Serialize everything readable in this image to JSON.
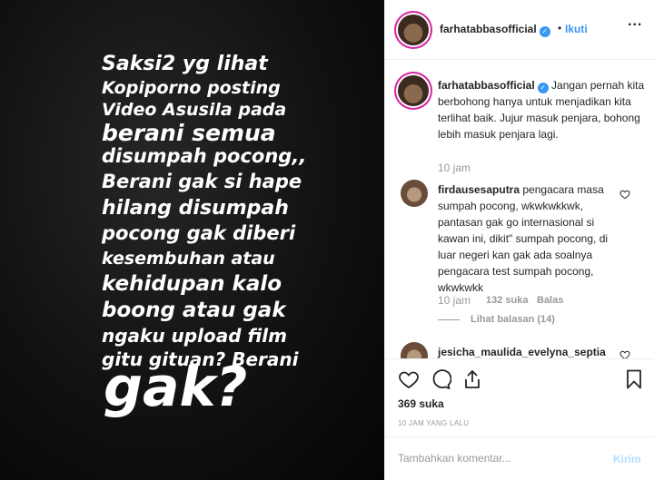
{
  "image_text": {
    "lines": [
      "Saksi2 yg lihat",
      "Kopiporno posting",
      "Video Asusila pada",
      "berani semua",
      "disumpah pocong,,",
      "Berani gak si hape",
      "hilang disumpah",
      "pocong gak diberi",
      "kesembuhan atau",
      "kehidupan kalo",
      "boong atau gak",
      "ngaku upload film",
      "gitu gituan? Berani",
      "gak?"
    ]
  },
  "header": {
    "username": "farhatabbasofficial",
    "verified_icon": "verified-badge-icon",
    "separator": "•",
    "follow_label": "Ikuti",
    "more_icon": "more-options-icon",
    "more_label": "..."
  },
  "caption": {
    "username": "farhatabbasofficial",
    "text": "Jangan pernah kita berbohong hanya untuk menjadikan kita terlihat baik. Jujur masuk penjara, bohong lebih masuk penjara lagi.",
    "time": "10 jam"
  },
  "comments": [
    {
      "username": "firdausesaputra",
      "text": "pengacara masa sumpah pocong, wkwkwkkwk, pantasan gak go internasional si kawan ini, dikit\" sumpah pocong, di luar negeri kan gak ada soalnya pengacara test sumpah pocong, wkwkwkk",
      "time": "10 jam",
      "likes": "132 suka",
      "reply_label": "Balas",
      "view_replies": "Lihat balasan (14)"
    },
    {
      "username": "jesicha_maulida_evelyna_septia",
      "text": ""
    }
  ],
  "actions": {
    "like_icon": "heart-icon",
    "comment_icon": "comment-icon",
    "share_icon": "share-icon",
    "save_icon": "bookmark-icon",
    "likes": "369 suka",
    "posted": "10 JAM YANG LALU"
  },
  "add_comment": {
    "placeholder": "Tambahkan komentar...",
    "post_label": "Kirim"
  },
  "colors": {
    "accent": "#3897f0",
    "post_disabled": "#b2dffc",
    "muted": "#999999",
    "image_bg": "#111111"
  }
}
